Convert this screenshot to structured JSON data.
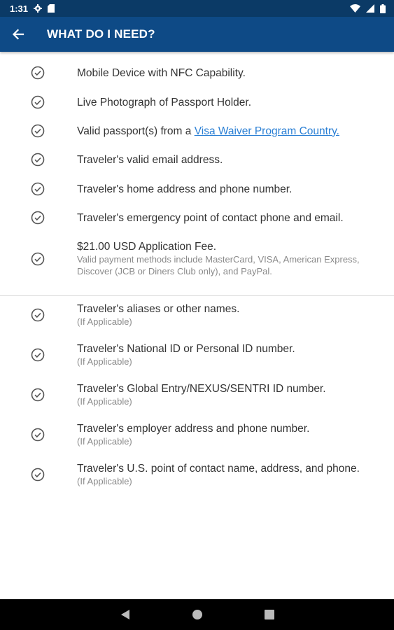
{
  "status_bar": {
    "time": "1:31"
  },
  "app_bar": {
    "title": "WHAT DO I NEED?"
  },
  "requirements": [
    {
      "text": "Mobile Device with NFC Capability."
    },
    {
      "text": "Live Photograph of Passport Holder."
    },
    {
      "text_before": "Valid passport(s) from a ",
      "link": "Visa Waiver Program Country."
    },
    {
      "text": "Traveler's valid email address."
    },
    {
      "text": "Traveler's home address and phone number."
    },
    {
      "text": "Traveler's emergency point of contact phone and email."
    },
    {
      "text": "$21.00 USD Application Fee.",
      "note": "Valid payment methods include MasterCard, VISA, American Express, Discover (JCB or Diners Club only), and PayPal."
    }
  ],
  "optional_label": "(If Applicable)",
  "optional_requirements": [
    {
      "text": "Traveler's aliases or other names."
    },
    {
      "text": "Traveler's National ID or Personal ID number."
    },
    {
      "text": "Traveler's Global Entry/NEXUS/SENTRI ID number."
    },
    {
      "text": "Traveler's employer address and phone number."
    },
    {
      "text": "Traveler's U.S. point of contact name, address, and phone."
    }
  ],
  "icons": {
    "check": "check-circle-icon",
    "back": "arrow-left-icon"
  },
  "colors": {
    "app_bar": "#0e4a86",
    "status_bar": "#0b3a66",
    "link": "#2a7fd4"
  }
}
